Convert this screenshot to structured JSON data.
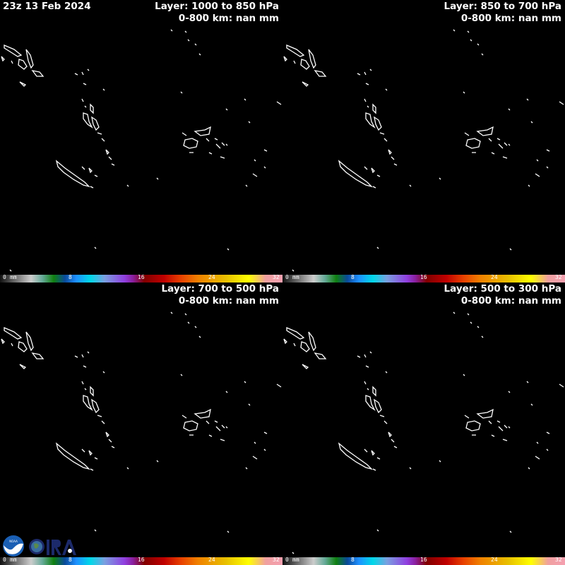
{
  "timestamp": "23z 13 Feb 2024",
  "panels": [
    {
      "layer": "Layer: 1000 to 850 hPa",
      "summary": "0-800 km: nan mm"
    },
    {
      "layer": "Layer: 850 to 700 hPa",
      "summary": "0-800 km: nan mm"
    },
    {
      "layer": "Layer: 700 to 500 hPa",
      "summary": "0-800 km: nan mm"
    },
    {
      "layer": "Layer: 500 to 300 hPa",
      "summary": "0-800 km: nan mm"
    }
  ],
  "colorbar": {
    "unit": "mm",
    "ticks": [
      "0",
      "8",
      "16",
      "24",
      "32"
    ]
  },
  "logos": [
    "NOAA",
    "CIRA"
  ]
}
